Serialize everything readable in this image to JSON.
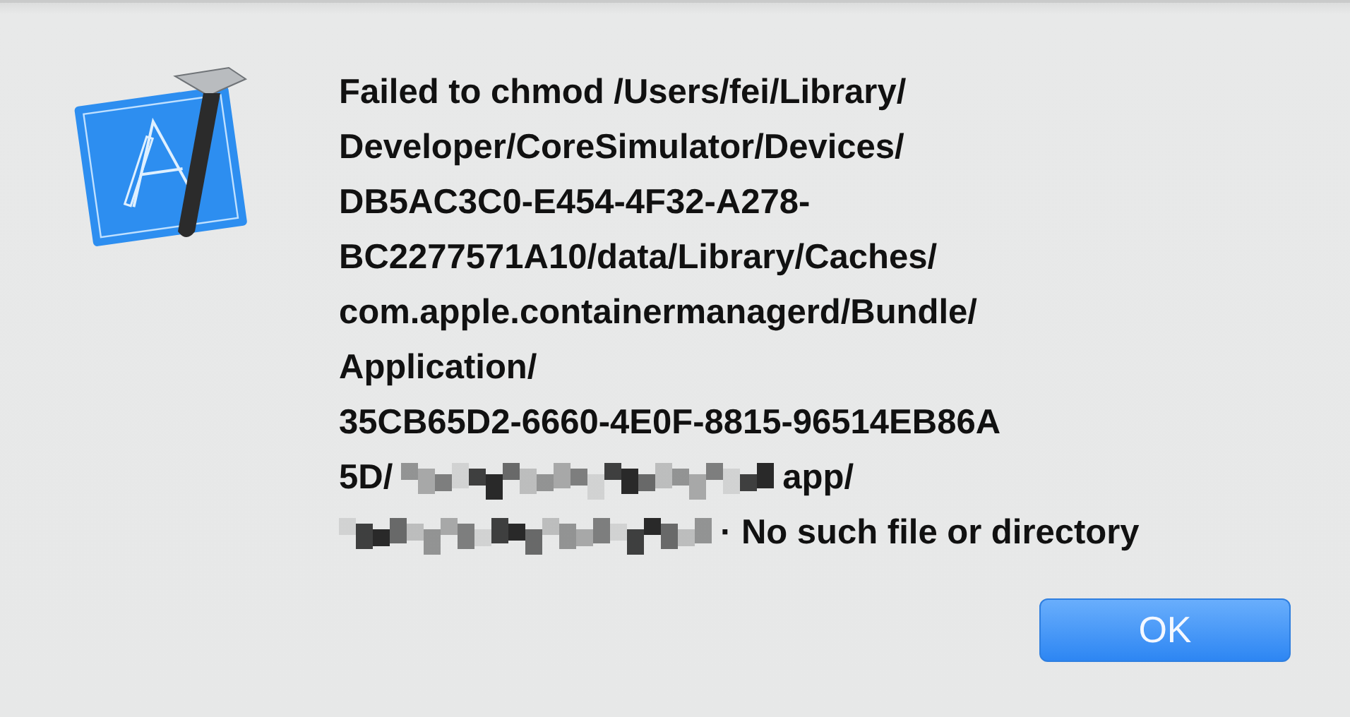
{
  "alert": {
    "message_lines": [
      [
        {
          "kind": "text",
          "text": "Failed to chmod /Users/fei/Library/"
        }
      ],
      [
        {
          "kind": "text",
          "text": "Developer/CoreSimulator/Devices/"
        }
      ],
      [
        {
          "kind": "text",
          "text": "DB5AC3C0-E454-4F32-A278-"
        }
      ],
      [
        {
          "kind": "text",
          "text": "BC2277571A10/data/Library/Caches/"
        }
      ],
      [
        {
          "kind": "text",
          "text": "com.apple.containermanagerd/Bundle/"
        }
      ],
      [
        {
          "kind": "text",
          "text": "Application/"
        }
      ],
      [
        {
          "kind": "text",
          "text": "35CB65D2-6660-4E0F-8815-96514EB86A"
        }
      ],
      [
        {
          "kind": "text",
          "text": "5D/"
        },
        {
          "kind": "redacted"
        },
        {
          "kind": "text",
          "text": "app/"
        }
      ],
      [
        {
          "kind": "redacted"
        },
        {
          "kind": "text",
          "text": "· No such file or directory"
        }
      ]
    ],
    "buttons": [
      {
        "label": "OK",
        "default": true
      }
    ]
  }
}
